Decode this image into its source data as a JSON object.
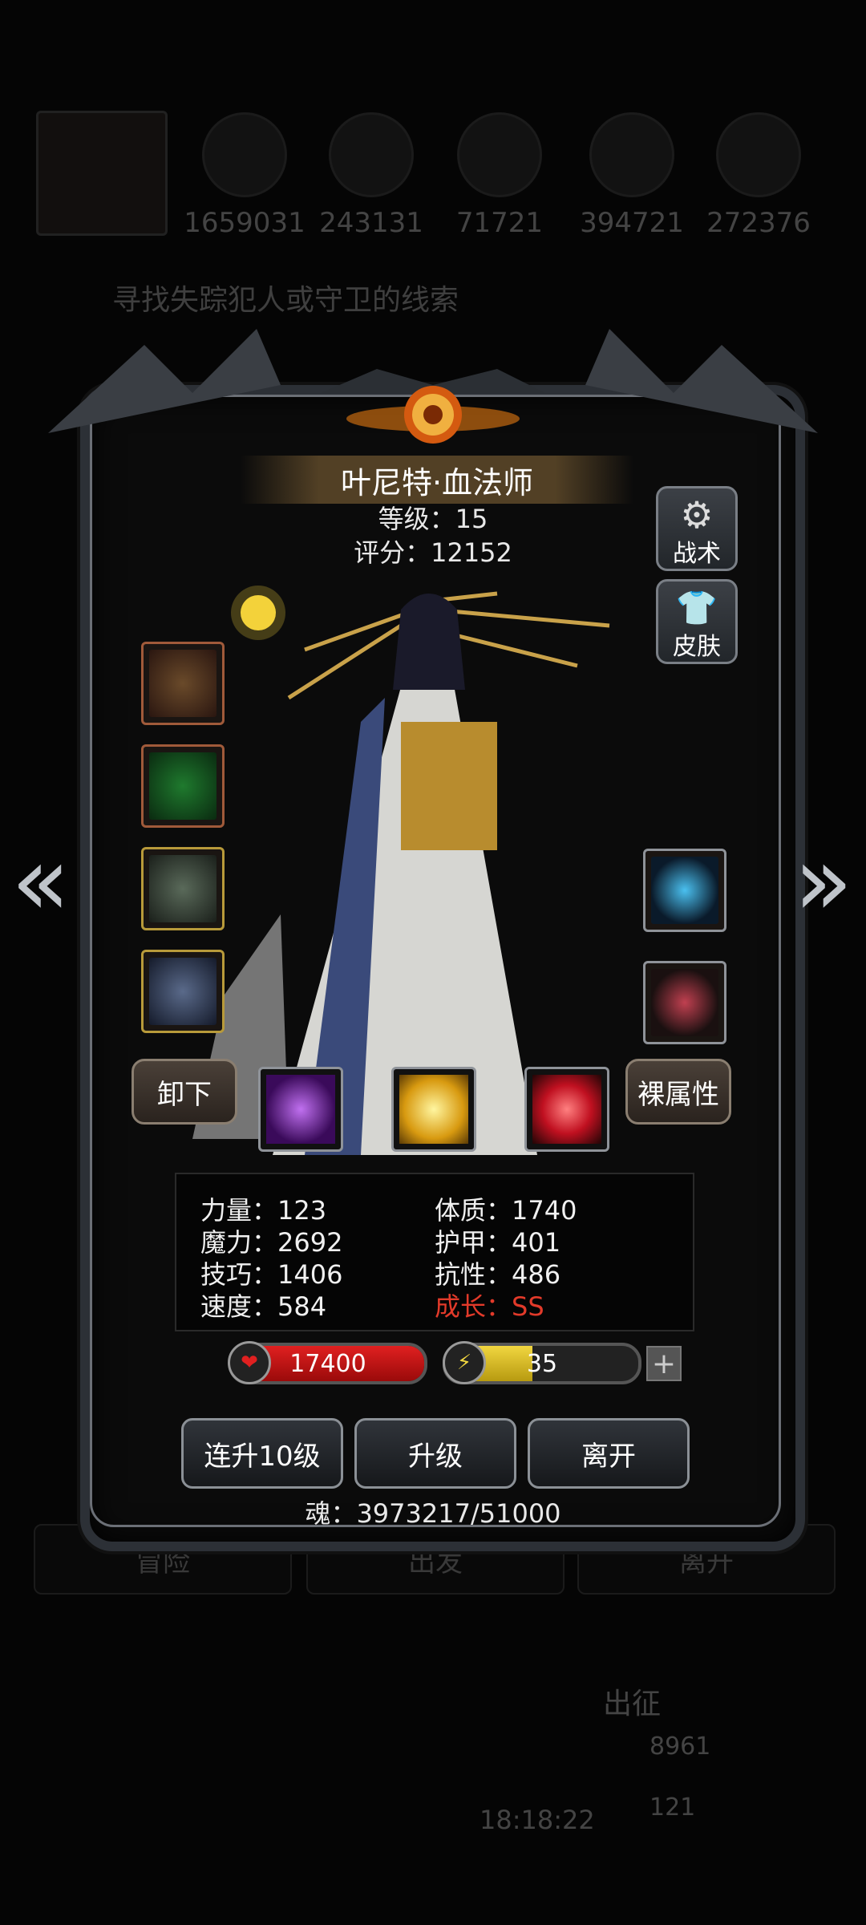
{
  "background": {
    "resources": [
      "1659031",
      "243131",
      "71721",
      "394721",
      "272376"
    ],
    "quest_text": "寻找失踪犯人或守卫的线索",
    "bottom_tabs": [
      "冒险",
      "出发",
      "离开"
    ],
    "expedition_label": "出征",
    "gold_value": "8961",
    "gem_value": "121",
    "timer": "18:18:22"
  },
  "hero": {
    "name": "叶尼特·血法师",
    "level_text": "等级：15",
    "score_text": "评分：12152"
  },
  "side_buttons": {
    "tactics": "战术",
    "skin": "皮肤"
  },
  "buttons": {
    "unequip": "卸下",
    "base_attributes": "裸属性",
    "level_up_10": "连升10级",
    "level_up": "升级",
    "leave": "离开"
  },
  "stats": {
    "strength": "力量：123",
    "magic": "魔力：2692",
    "skill": "技巧：1406",
    "speed": "速度：584",
    "constitution": "体质：1740",
    "armor": "护甲：401",
    "resistance": "抗性：486",
    "growth": "成长：SS"
  },
  "hp": {
    "value": "17400",
    "fill": 1.0
  },
  "energy": {
    "value": "35",
    "fill": 0.45
  },
  "soul_text": "魂：3973217/51000",
  "colors": {
    "hp": "#d81818",
    "energy": "#e6c830",
    "growth": "#e23a2a"
  }
}
